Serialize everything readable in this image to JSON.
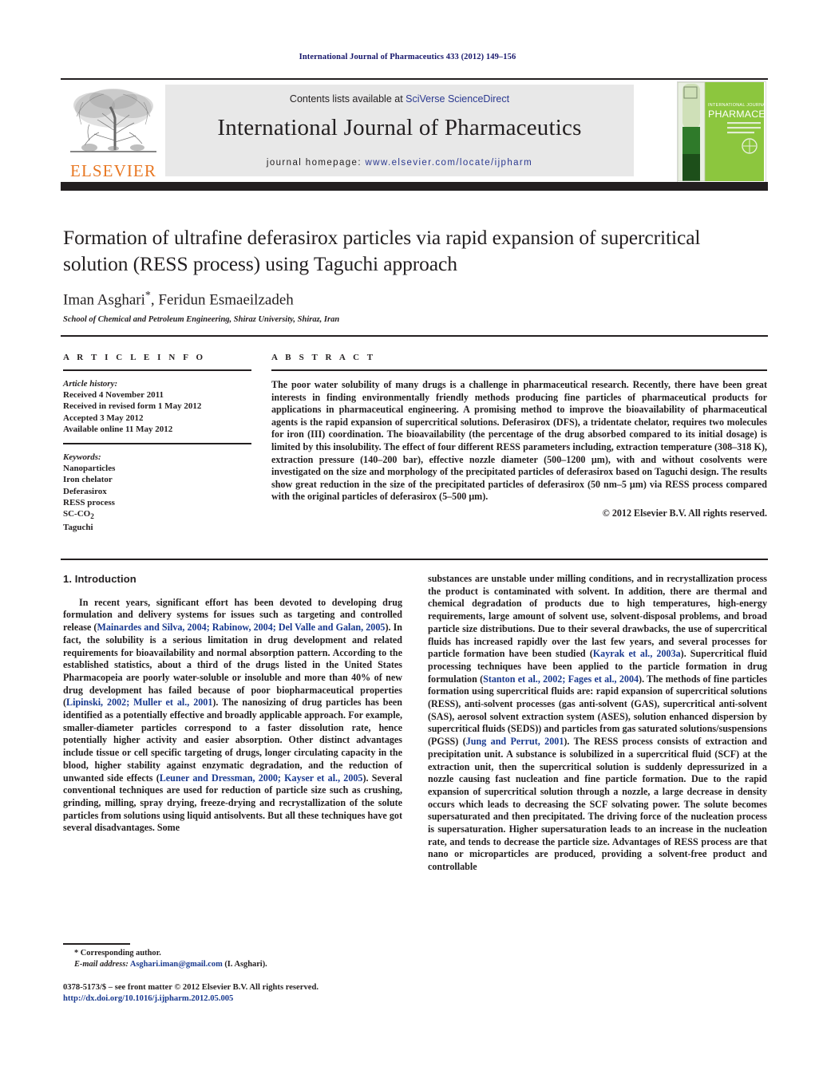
{
  "running_head": "International Journal of Pharmaceutics 433 (2012) 149–156",
  "masthead": {
    "publisher_name": "ELSEVIER",
    "contents_prefix": "Contents lists available at ",
    "contents_link": "SciVerse ScienceDirect",
    "journal_title": "International Journal of Pharmaceutics",
    "homepage_prefix": "journal homepage: ",
    "homepage_url": "www.elsevier.com/locate/ijpharm",
    "cover_title_top": "INTERNATIONAL JOURNAL OF",
    "cover_title_main": "PHARMACEUTICS",
    "cover_color": "#8cc63e"
  },
  "article": {
    "title": "Formation of ultrafine deferasirox particles via rapid expansion of supercritical solution (RESS process) using Taguchi approach",
    "authors": "Iman Asghari",
    "authors_rest": ", Feridun Esmaeilzadeh",
    "corresponding_marker": "*",
    "affiliation": "School of Chemical and Petroleum Engineering, Shiraz University, Shiraz, Iran"
  },
  "article_info": {
    "label": "A R T I C L E   I N F O",
    "history_label": "Article history:",
    "history": [
      "Received 4 November 2011",
      "Received in revised form 1 May 2012",
      "Accepted 3 May 2012",
      "Available online 11 May 2012"
    ],
    "keywords_label": "Keywords:",
    "keywords": [
      "Nanoparticles",
      "Iron chelator",
      "Deferasirox",
      "RESS process",
      "SC-CO2",
      "Taguchi"
    ],
    "keyword_sc_co2_base": "SC-CO",
    "keyword_sc_co2_sub": "2"
  },
  "abstract": {
    "label": "A B S T R A C T",
    "text": "The poor water solubility of many drugs is a challenge in pharmaceutical research. Recently, there have been great interests in finding environmentally friendly methods producing fine particles of pharmaceutical products for applications in pharmaceutical engineering. A promising method to improve the bioavailability of pharmaceutical agents is the rapid expansion of supercritical solutions. Deferasirox (DFS), a tridentate chelator, requires two molecules for iron (III) coordination. The bioavailability (the percentage of the drug absorbed compared to its initial dosage) is limited by this insolubility. The effect of four different RESS parameters including, extraction temperature (308–318 K), extraction pressure (140–200 bar), effective nozzle diameter (500–1200 μm), with and without cosolvents were investigated on the size and morphology of the precipitated particles of deferasirox based on Taguchi design. The results show great reduction in the size of the precipitated particles of deferasirox (50 nm–5 μm) via RESS process compared with the original particles of deferasirox (5–500 μm).",
    "copyright": "© 2012 Elsevier B.V. All rights reserved."
  },
  "body": {
    "section_number_title": "1.  Introduction",
    "left_paragraph_1_a": "In recent years, significant effort has been devoted to developing drug formulation and delivery systems for issues such as targeting and controlled release (",
    "left_ref_1": "Mainardes and Silva, 2004; Rabinow, 2004; Del Valle and Galan, 2005",
    "left_paragraph_1_b": "). In fact, the solubility is a serious limitation in drug development and related requirements for bioavailability and normal absorption pattern. According to the established statistics, about a third of the drugs listed in the United States Pharmacopeia are poorly water-soluble or insoluble and more than 40% of new drug development has failed because of poor biopharmaceutical properties (",
    "left_ref_2": "Lipinski, 2002; Muller et al., 2001",
    "left_paragraph_1_c": "). The nanosizing of drug particles has been identified as a potentially effective and broadly applicable approach. For example, smaller-diameter particles correspond to a faster dissolution rate, hence potentially higher activity and easier absorption. Other distinct advantages include tissue or cell specific targeting of drugs, longer circulating capacity in the blood, higher stability against enzymatic degradation, and the reduction of unwanted side effects (",
    "left_ref_3": "Leuner and Dressman, 2000; Kayser et al., 2005",
    "left_paragraph_1_d": "). Several conventional techniques are used for reduction of particle size such as crushing, grinding, milling, spray drying, freeze-drying and recrystallization of the solute particles from solutions using liquid antisolvents. But all these techniques have got several disadvantages. Some",
    "right_paragraph_a": "substances are unstable under milling conditions, and in recrystallization process the product is contaminated with solvent. In addition, there are thermal and chemical degradation of products due to high temperatures, high-energy requirements, large amount of solvent use, solvent-disposal problems, and broad particle size distributions. Due to their several drawbacks, the use of supercritical fluids has increased rapidly over the last few years, and several processes for particle formation have been studied (",
    "right_ref_1": "Kayrak et al., 2003a",
    "right_paragraph_b": "). Supercritical fluid processing techniques have been applied to the particle formation in drug formulation (",
    "right_ref_2": "Stanton et al., 2002; Fages et al., 2004",
    "right_paragraph_c": "). The methods of fine particles formation using supercritical fluids are: rapid expansion of supercritical solutions (RESS), anti-solvent processes (gas anti-solvent (GAS), supercritical anti-solvent (SAS), aerosol solvent extraction system (ASES), solution enhanced dispersion by supercritical fluids (SEDS)) and particles from gas saturated solutions/suspensions (PGSS) (",
    "right_ref_3": "Jung and Perrut, 2001",
    "right_paragraph_d": "). The RESS process consists of extraction and precipitation unit. A substance is solubilized in a supercritical fluid (SCF) at the extraction unit, then the supercritical solution is suddenly depressurized in a nozzle causing fast nucleation and fine particle formation. Due to the rapid expansion of supercritical solution through a nozzle, a large decrease in density occurs which leads to decreasing the SCF solvating power. The solute becomes supersaturated and then precipitated. The driving force of the nucleation process is supersaturation. Higher supersaturation leads to an increase in the nucleation rate, and tends to decrease the particle size. Advantages of RESS process are that nano or microparticles are produced, providing a solvent-free product and controllable"
  },
  "footnotes": {
    "corresponding": "* Corresponding author.",
    "email_label": "E-mail address:",
    "email": "Asghari.iman@gmail.com",
    "email_suffix": " (I. Asghari).",
    "issn_line": "0378-5173/$ – see front matter © 2012 Elsevier B.V. All rights reserved.",
    "doi": "http://dx.doi.org/10.1016/j.ijpharm.2012.05.005"
  },
  "colors": {
    "link": "#1a3a8f",
    "elsevier_orange": "#e87722",
    "band_gray": "#e8e8e8",
    "rule_dark": "#231f20"
  }
}
